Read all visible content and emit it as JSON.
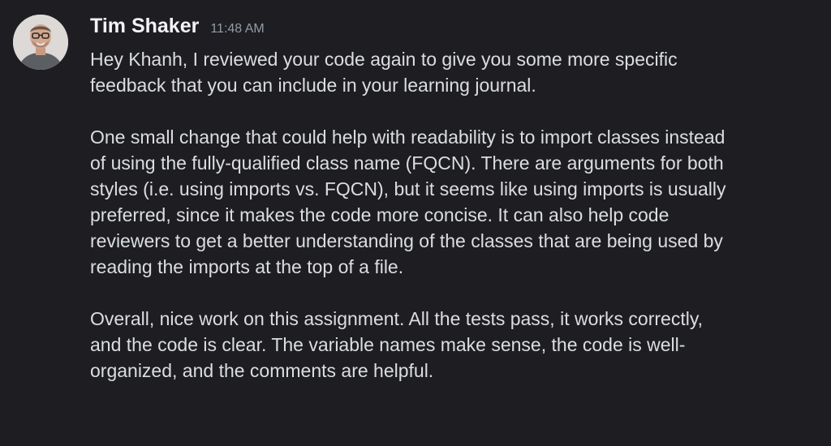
{
  "message": {
    "author": "Tim Shaker",
    "timestamp": "11:48 AM",
    "avatar_icon": "user-avatar-photo",
    "paragraphs": [
      "Hey Khanh, I reviewed your code again to give you some more specific\nfeedback that you can include in your learning journal.",
      "One small change that could help with readability is to import classes instead\nof using the fully-qualified class name (FQCN). There are arguments for both\nstyles (i.e. using imports vs. FQCN), but it seems like using imports is usually\npreferred, since it makes the code more concise. It can also help code\nreviewers to get a better understanding of the classes that are being used by\nreading the imports at the top of a file.",
      "Overall, nice work on this assignment. All the tests pass, it works correctly,\nand the code is clear. The variable names make sense, the code is well-\norganized, and the comments are helpful."
    ]
  },
  "colors": {
    "background": "#1e1e22",
    "author": "#f2f3f5",
    "timestamp": "#949ba4",
    "text": "#dbdee1"
  }
}
